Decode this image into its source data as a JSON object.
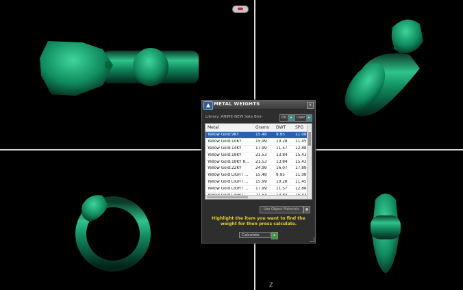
{
  "dialog": {
    "title": "METAL WEIGHTS",
    "close_glyph": "x",
    "library_label": "Library: ANIME-NEW Sate Blor-",
    "library_btn_a": "0V",
    "library_btn_b": "User",
    "arrow_glyph": "▸",
    "columns": [
      "Metal",
      "Grams",
      "DWT",
      "SPG"
    ],
    "rows": [
      [
        "Yellow Gold:9KY",
        "15.48",
        "9.95",
        "11.08"
      ],
      [
        "Yellow Gold:10KY",
        "15.99",
        "10.28",
        "11.45"
      ],
      [
        "Yellow Gold:14KY",
        "17.99",
        "11.57",
        "12.88"
      ],
      [
        "Yellow Gold:18KY",
        "21.53",
        "13.84",
        "15.43"
      ],
      [
        "Yellow Gold:18KY R...",
        "21.53",
        "13.84",
        "15.43"
      ],
      [
        "Yellow Gold:22KY",
        "24.99",
        "16.07",
        "17.89"
      ],
      [
        "Yellow Gold LIGHT ...",
        "15.48",
        "9.95",
        "11.08"
      ],
      [
        "Yellow Gold LIGHT ...",
        "15.99",
        "10.28",
        "11.45"
      ],
      [
        "Yellow Gold LIGHT ...",
        "17.99",
        "11.57",
        "12.88"
      ],
      [
        "Yellow Gold LIGHT ...",
        "21.53",
        "13.84",
        "15.43"
      ],
      [
        "Yellow Gold LIGHT ...",
        "21.53",
        "13.84",
        "15.43"
      ]
    ],
    "selected_row": 0,
    "use_object_materials": "Use Object Materials",
    "instructions": "Highlight the item you want to find the weight for then press calculate.",
    "calculate_label": "Calculate",
    "calculate_glyph": "▸"
  },
  "viewport": {
    "axis_label": "Z",
    "model_color": "#0f8a5f"
  }
}
